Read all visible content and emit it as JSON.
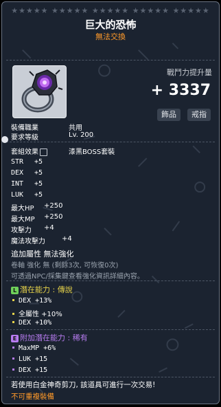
{
  "header": {
    "stars": "★★★★★ ★★★★★ ★★★★★ ★★★★★ ★★★★★",
    "title": "巨大的恐怖",
    "tradable": "無法交換"
  },
  "icon": {
    "name": "giant-terror-ring-icon"
  },
  "power": {
    "label": "戰鬥力提升量",
    "value": "+ 3337"
  },
  "buttons": {
    "category": "飾品",
    "slot": "戒指"
  },
  "requirements": {
    "job_label": "裝備職業",
    "job_value": "共用",
    "level_label": "要求等級",
    "level_value": "Lv. 200"
  },
  "set": {
    "label": "套組效果",
    "value": "漆黑BOSS套裝"
  },
  "stats": [
    {
      "name": "STR",
      "value": "+5"
    },
    {
      "name": "DEX",
      "value": "+5"
    },
    {
      "name": "INT",
      "value": "+5"
    },
    {
      "name": "LUK",
      "value": "+5"
    },
    {
      "name": "最大HP",
      "value": "+250"
    },
    {
      "name": "最大MP",
      "value": "+250"
    },
    {
      "name": "攻擊力",
      "value": "+4"
    },
    {
      "name": "魔法攻擊力",
      "value": "+4"
    }
  ],
  "extra": {
    "line": "追加屬性 無法強化",
    "scroll": "卷軸 強化 無 (剩餘3次, 可恢復0次)",
    "npc": "可透過NPC/採集鍵查看強化資訊詳細內容。"
  },
  "potential": {
    "badge": "L",
    "label": "潛在能力 : 傳說",
    "lines": [
      "DEX +13%",
      "全屬性 +10%",
      "DEX +10%"
    ]
  },
  "bonus": {
    "badge": "E",
    "label": "附加潛在能力 : 稀有",
    "lines": [
      "MaxMP +6%",
      "LUK +15",
      "DEX +15"
    ]
  },
  "footer": {
    "scissors": "若使用白金神奇剪刀, 該道具可進行一次交易!",
    "reset": "不可重複裝備"
  }
}
